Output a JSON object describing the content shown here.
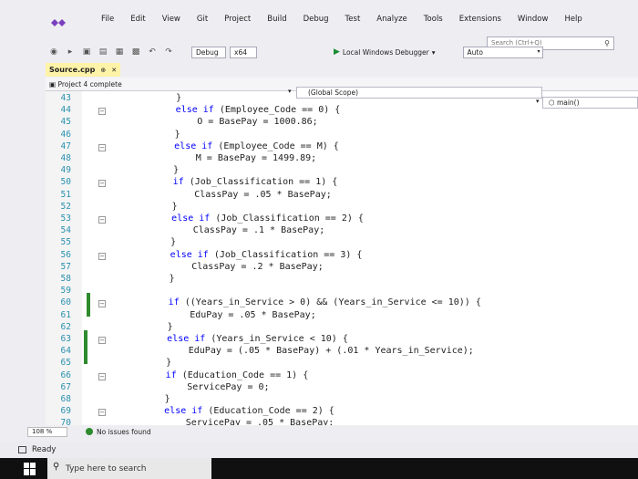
{
  "menu": [
    "File",
    "Edit",
    "View",
    "Git",
    "Project",
    "Build",
    "Debug",
    "Test",
    "Analyze",
    "Tools",
    "Extensions",
    "Window",
    "Help"
  ],
  "search": {
    "placeholder": "Search (Ctrl+Q)"
  },
  "toolbar": {
    "config": "Debug",
    "platform": "x64",
    "run_label": "Local Windows Debugger",
    "auto": "Auto"
  },
  "tab": {
    "name": "Source.cpp",
    "pin": "⊕",
    "close": "✕"
  },
  "nav": {
    "project": "Project 4 complete",
    "scope": "(Global Scope)",
    "member": "main()"
  },
  "code_lines": [
    {
      "n": "43",
      "t": "        }"
    },
    {
      "n": "44",
      "t": "        else if (Employee_Code == 0) {"
    },
    {
      "n": "45",
      "t": "            O = BasePay = 1000.86;"
    },
    {
      "n": "46",
      "t": "        }"
    },
    {
      "n": "47",
      "t": "        else if (Employee_Code == M) {"
    },
    {
      "n": "48",
      "t": "            M = BasePay = 1499.89;"
    },
    {
      "n": "49",
      "t": "        }"
    },
    {
      "n": "50",
      "t": "        if (Job_Classification == 1) {"
    },
    {
      "n": "51",
      "t": "            ClassPay = .05 * BasePay;"
    },
    {
      "n": "52",
      "t": "        }"
    },
    {
      "n": "53",
      "t": "        else if (Job_Classification == 2) {"
    },
    {
      "n": "54",
      "t": "            ClassPay = .1 * BasePay;"
    },
    {
      "n": "55",
      "t": "        }"
    },
    {
      "n": "56",
      "t": "        else if (Job_Classification == 3) {"
    },
    {
      "n": "57",
      "t": "            ClassPay = .2 * BasePay;"
    },
    {
      "n": "58",
      "t": "        }"
    },
    {
      "n": "59",
      "t": ""
    },
    {
      "n": "60",
      "t": "        if ((Years_in_Service > 0) && (Years_in_Service <= 10)) {"
    },
    {
      "n": "61",
      "t": "            EduPay = .05 * BasePay;"
    },
    {
      "n": "62",
      "t": "        }"
    },
    {
      "n": "63",
      "t": "        else if (Years_in_Service < 10) {"
    },
    {
      "n": "64",
      "t": "            EduPay = (.05 * BasePay) + (.01 * Years_in_Service);"
    },
    {
      "n": "65",
      "t": "        }"
    },
    {
      "n": "66",
      "t": "        if (Education_Code == 1) {"
    },
    {
      "n": "67",
      "t": "            ServicePay = 0;"
    },
    {
      "n": "68",
      "t": "        }"
    },
    {
      "n": "69",
      "t": "        else if (Education_Code == 2) {"
    },
    {
      "n": "70",
      "t": "            ServicePay = .05 * BasePay;"
    }
  ],
  "status": {
    "zoom": "108 %",
    "issues": "No issues found",
    "ready": "Ready"
  },
  "taskbar": {
    "search": "Type here to search"
  },
  "colors": {
    "keyword": "#0000ff",
    "line_number": "#2b91af",
    "tab_active": "#fff3a8",
    "change_bar": "#2e8b2e"
  }
}
